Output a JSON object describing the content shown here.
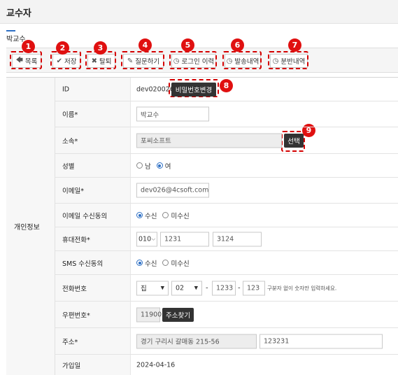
{
  "header": {
    "title": "교수자"
  },
  "profile_tab": {
    "name": "박교수"
  },
  "toolbar": {
    "list_label": "목록",
    "save_label": "저장",
    "withdraw_label": "탈퇴",
    "question_label": "질문하기",
    "login_history_label": "로그인 이력",
    "send_history_label": "발송내역",
    "distribution_label": "분반내역"
  },
  "callouts": [
    "1",
    "2",
    "3",
    "4",
    "5",
    "6",
    "7",
    "8",
    "9"
  ],
  "section": {
    "label": "개인정보"
  },
  "fields": {
    "id": {
      "label": "ID",
      "value": "dev020026",
      "button": "비밀번호변경"
    },
    "name": {
      "label": "이름*",
      "value": "박교수"
    },
    "affiliation": {
      "label": "소속*",
      "value": "포씨소프트",
      "button": "선택"
    },
    "gender": {
      "label": "성별",
      "options": [
        "남",
        "여"
      ],
      "selected": "여"
    },
    "email": {
      "label": "이메일*",
      "value": "dev026@4csoft.com"
    },
    "email_consent": {
      "label": "이메일 수신동의",
      "options": [
        "수신",
        "미수신"
      ],
      "selected": "수신"
    },
    "mobile": {
      "label": "휴대전화*",
      "prefix": "010",
      "middle": "1231",
      "last": "3124"
    },
    "sms_consent": {
      "label": "SMS 수신동의",
      "options": [
        "수신",
        "미수신"
      ],
      "selected": "수신"
    },
    "phone": {
      "label": "전화번호",
      "type": "집",
      "area": "02",
      "middle": "1233",
      "last": "123",
      "hint": "구분자 없이 숫자만 입력하세요."
    },
    "zipcode": {
      "label": "우편번호*",
      "value": "11900",
      "button": "주소찾기"
    },
    "address": {
      "label": "주소*",
      "value": "경기 구리시 갈매동 215-56",
      "detail": "123231"
    },
    "joined": {
      "label": "가입일",
      "value": "2024-04-16"
    }
  },
  "colors": {
    "accent": "#2d6fc4",
    "callout": "#e01010",
    "dark_button": "#333333"
  }
}
